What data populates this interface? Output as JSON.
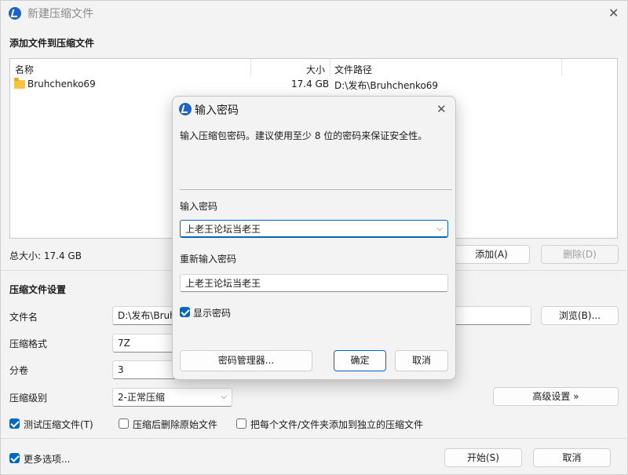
{
  "window": {
    "title": "新建压缩文件",
    "close_glyph": "✕"
  },
  "files_section": {
    "title": "添加文件到压缩文件",
    "columns": [
      "名称",
      "大小",
      "文件路径"
    ],
    "rows": [
      {
        "name": "Bruhchenko69",
        "size": "17.4 GB",
        "path": "D:\\发布\\Bruhchenko69",
        "icon": "folder-icon"
      }
    ],
    "total_size": "总大小: 17.4 GB",
    "add_label": "添加(A)",
    "delete_label": "删除(D)"
  },
  "settings": {
    "title": "压缩文件设置",
    "filename_label": "文件名",
    "filename_value": "D:\\发布\\Bruh",
    "browse_label": "浏览(B)...",
    "format_label": "压缩格式",
    "format_value": "7Z",
    "volume_label": "分卷",
    "volume_value": "3",
    "level_label": "压缩级别",
    "level_value": "2-正常压缩",
    "advanced_label": "高级设置 »",
    "test_label": "测试压缩文件(T)",
    "delete_after_label": "压缩后删除原始文件",
    "separate_label": "把每个文件/文件夹添加到独立的压缩文件",
    "more_options_label": "更多选项...",
    "start_label": "开始(S)",
    "cancel_label": "取消"
  },
  "dialog": {
    "title": "输入密码",
    "close_glyph": "✕",
    "description": "输入压缩包密码。建议使用至少 8 位的密码来保证安全性。",
    "password_label": "输入密码",
    "password_value": "上老王论坛当老王",
    "reenter_label": "重新输入密码",
    "reenter_value": "上老王论坛当老王",
    "show_password_label": "显示密码",
    "manager_label": "密码管理器...",
    "ok_label": "确定",
    "cancel_label": "取消"
  },
  "colors": {
    "accent": "#0067c0",
    "folder": "#f5c542"
  }
}
